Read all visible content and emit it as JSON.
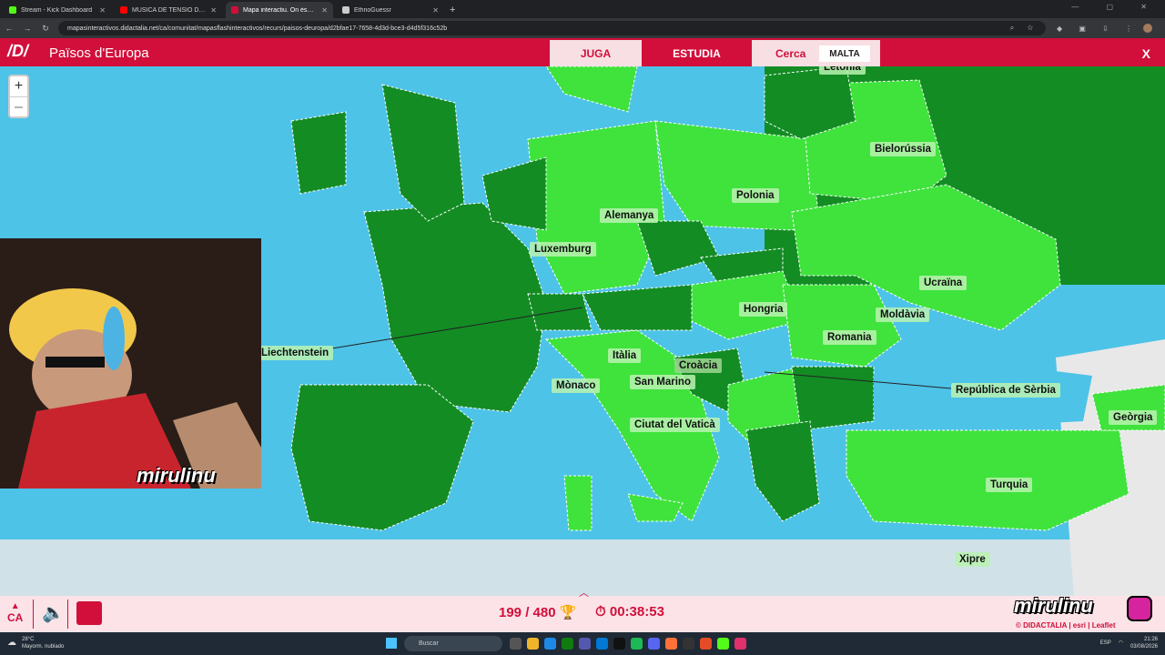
{
  "browser": {
    "tabs": [
      {
        "title": "Stream - Kick Dashboard",
        "fav_color": "#53fc18",
        "active": false
      },
      {
        "title": "MÚSICA DE TENSIÓ D\"EL",
        "fav_color": "#ff0000",
        "active": false
      },
      {
        "title": "Mapa interactiu. On és? Països",
        "fav_color": "#d10f3a",
        "active": true
      },
      {
        "title": "EthnoGuessr",
        "fav_color": "#cccccc",
        "active": false
      }
    ],
    "url": "mapasinteractivos.didactalia.net/ca/comunitat/mapasflashinteractivos/recurs/paisos-deuropa/d2bfae17-7658-4d3d-bce3-d4d5f316c52b"
  },
  "app": {
    "logo": "/D/",
    "title": "Països d'Europa",
    "juga": "JUGA",
    "estudia": "ESTUDIA",
    "cerca": "Cerca",
    "target": "MALTA",
    "close": "X"
  },
  "map": {
    "zoom_in": "+",
    "zoom_out": "–",
    "labels": {
      "letonia": "Letònia",
      "bielorussia": "Bielorússia",
      "polonia": "Polonia",
      "alemanya": "Alemanya",
      "luxemburg": "Luxemburg",
      "ucraina": "Ucraïna",
      "hongria": "Hongria",
      "moldavia": "Moldàvia",
      "romania": "Romania",
      "liechtenstein": "Liechtenstein",
      "italia": "Itàlia",
      "croacia": "Croàcia",
      "monaco": "Mònaco",
      "sanmarino": "San Marino",
      "serbia": "República de Sèrbia",
      "georgia": "Geòrgia",
      "vatica": "Ciutat del Vaticà",
      "turquia": "Turquia",
      "xipre": "Xipre"
    },
    "colors": {
      "sea": "#4dc3e8",
      "land_dark": "#138c24",
      "land_light": "#3fe33c",
      "land_gray": "#e8e8e8"
    }
  },
  "footer": {
    "lang": "CA",
    "score": "199 / 480",
    "timer": "00:38:53"
  },
  "overlay": {
    "cam_name": "mirulinu",
    "brand": "mirulinu",
    "credit": "© DIDACTALIA | esri | Leaflet"
  },
  "taskbar": {
    "weather_temp": "28°C",
    "weather_desc": "Mayorm. nublado",
    "search": "Buscar",
    "lang": "ESP",
    "time": "21:26",
    "date": "03/08/2026"
  }
}
